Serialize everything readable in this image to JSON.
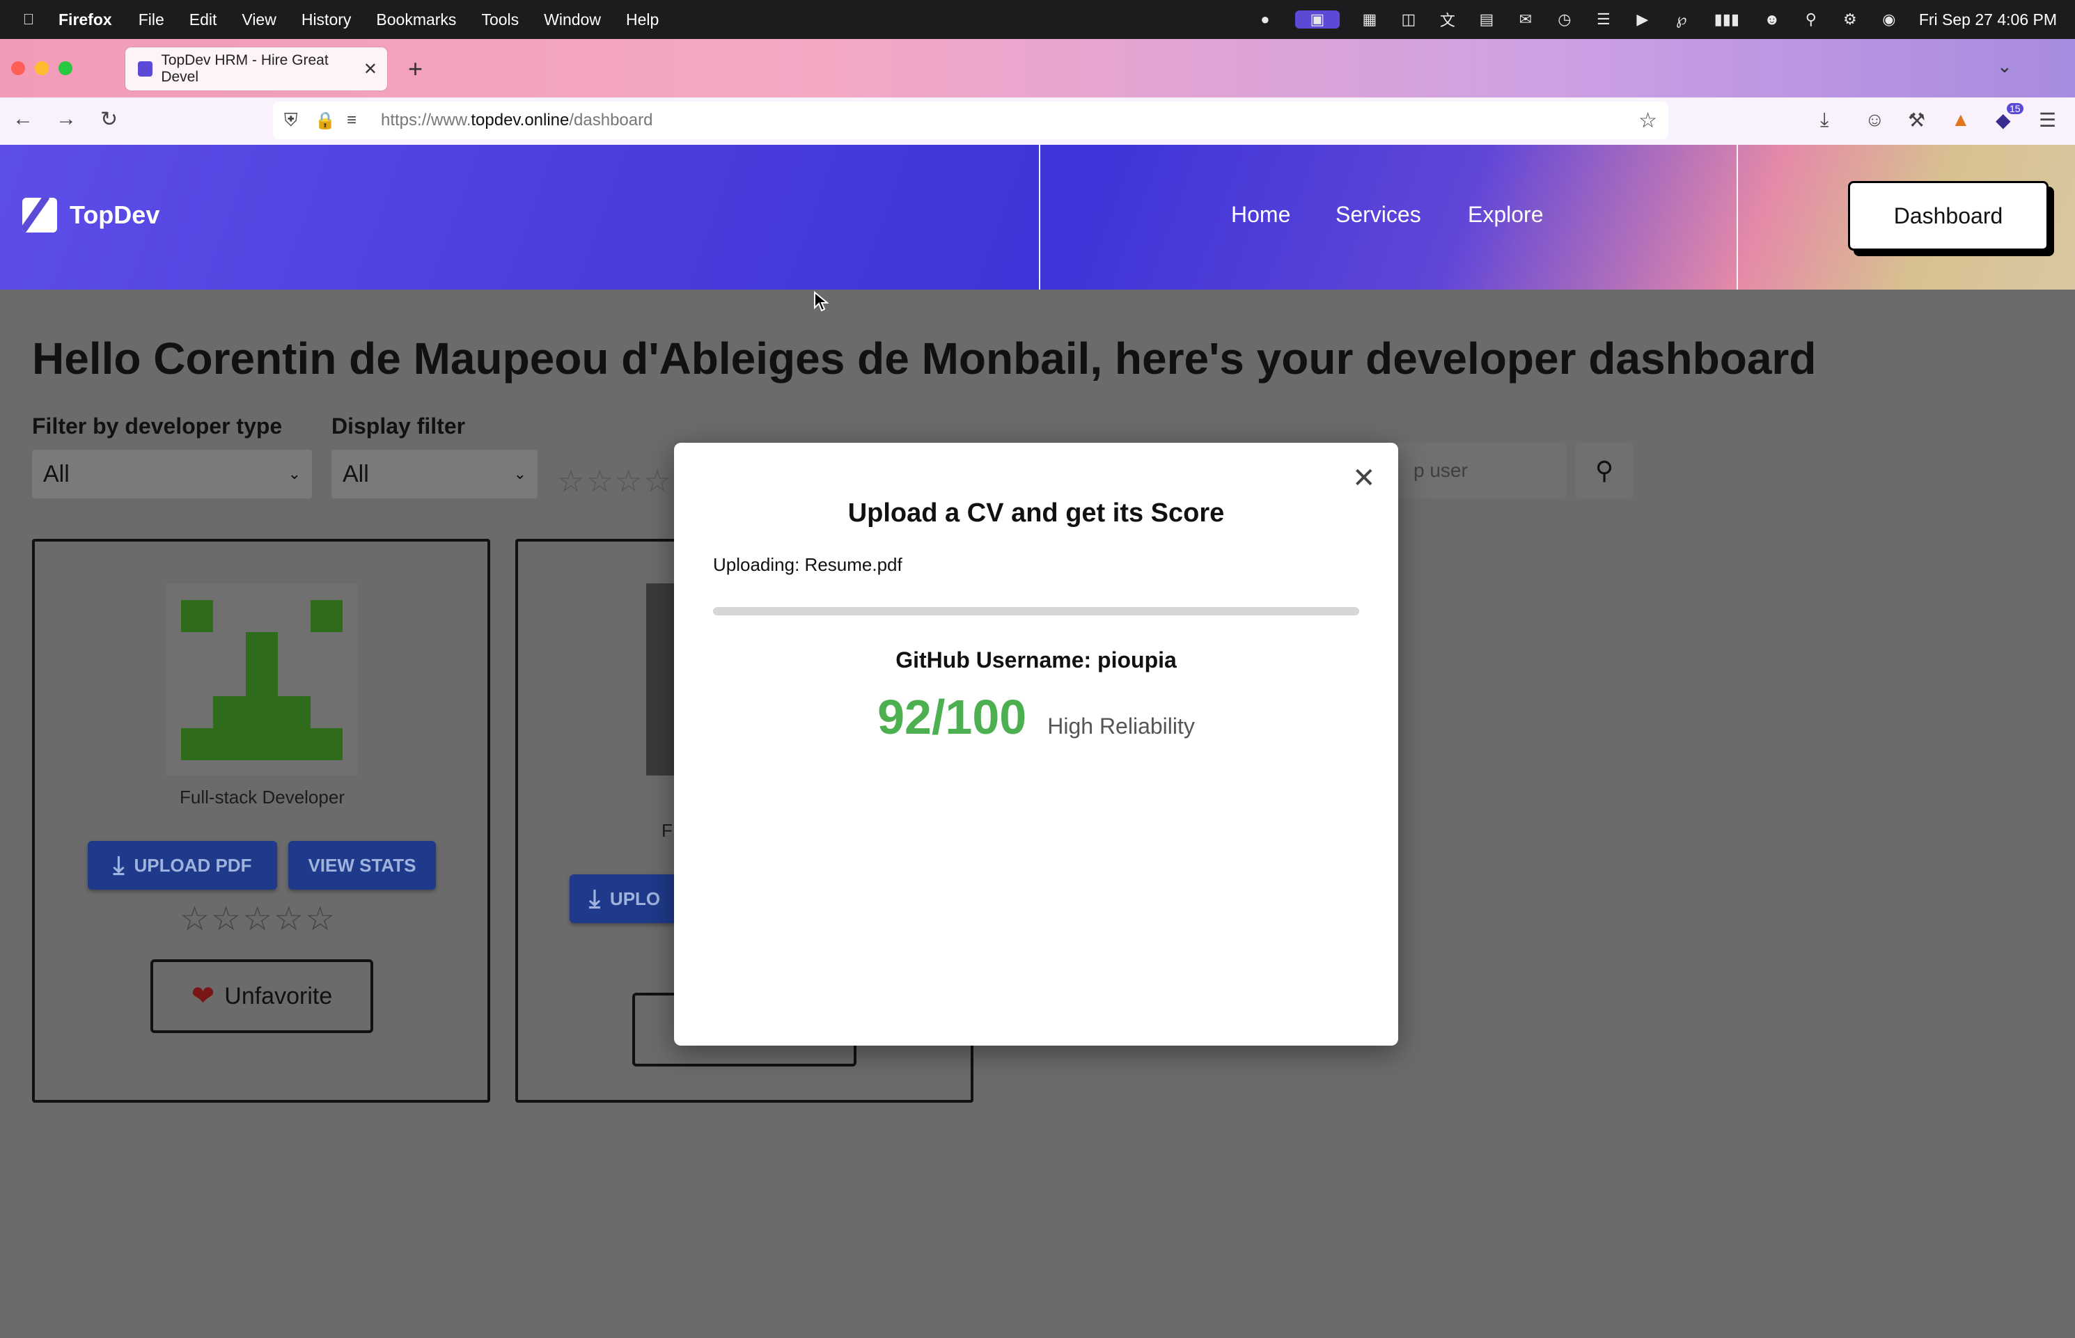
{
  "menubar": {
    "app": "Firefox",
    "items": [
      "File",
      "Edit",
      "View",
      "History",
      "Bookmarks",
      "Tools",
      "Window",
      "Help"
    ],
    "clock": "Fri Sep 27  4:06 PM"
  },
  "browser": {
    "tab_title": "TopDev HRM - Hire Great Devel",
    "url_prefix": "https://www.",
    "url_domain": "topdev.online",
    "url_path": "/dashboard",
    "extension_badge": "15"
  },
  "site": {
    "brand": "TopDev",
    "nav": [
      "Home",
      "Services",
      "Explore"
    ],
    "dashboard_button": "Dashboard"
  },
  "page": {
    "title": "Hello Corentin de Maupeou d'Ableiges de Monbail, here's your developer dashboard",
    "filter_type_label": "Filter by developer type",
    "filter_type_value": "All",
    "display_filter_label": "Display filter",
    "display_filter_value": "All",
    "search_placeholder_visible": "p user"
  },
  "cards": [
    {
      "role": "Full-stack Developer",
      "upload_label": "UPLOAD PDF",
      "stats_label": "VIEW STATS",
      "favorite_label": "Unfavorite"
    },
    {
      "role_visible": "F",
      "upload_label_visible": "UPLO"
    }
  ],
  "modal": {
    "title": "Upload a CV and get its Score",
    "uploading_text": "Uploading: Resume.pdf",
    "progress": 1.0,
    "github_label": "GitHub Username: pioupia",
    "score": "92/100",
    "reliability": "High Reliability",
    "score_color": "#4caf50"
  },
  "colors": {
    "primary_button": "#1f3a8a",
    "overlay": "#6b6b6b"
  }
}
